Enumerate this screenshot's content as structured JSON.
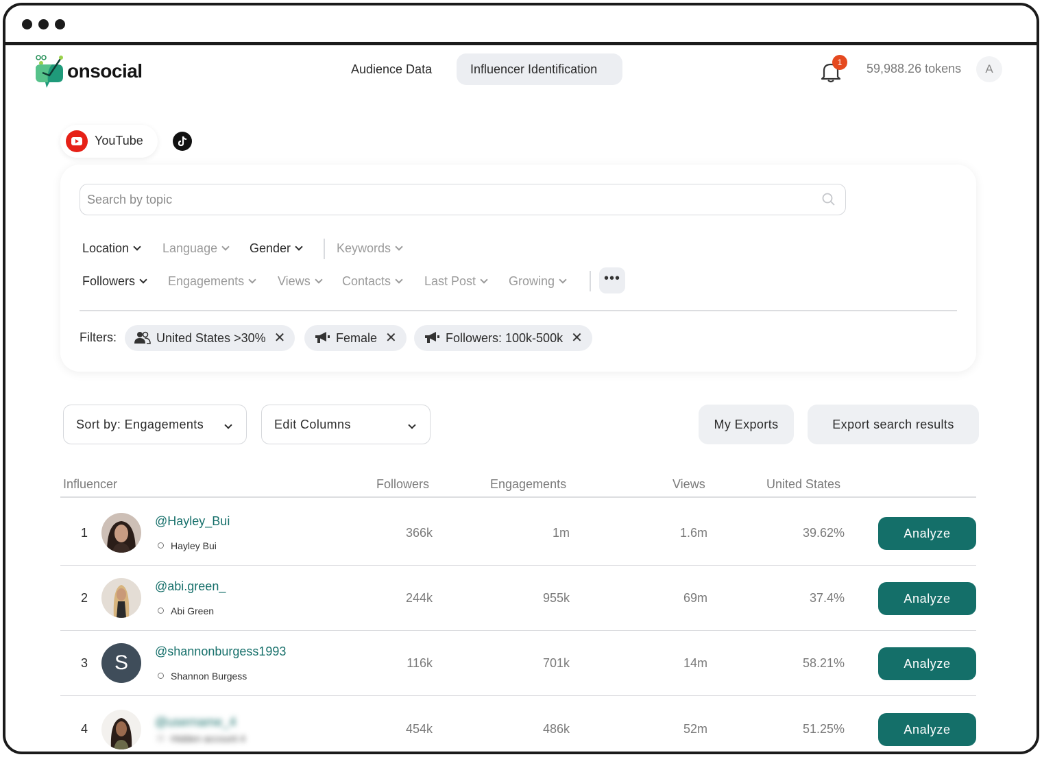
{
  "app": {
    "logo_text": "onsocial"
  },
  "nav": {
    "items": [
      {
        "label": "Audience Data",
        "active": false
      },
      {
        "label": "Influencer Identification",
        "active": true
      }
    ]
  },
  "header": {
    "notification_count": "1",
    "tokens": "59,988.26 tokens",
    "avatar_initial": "A"
  },
  "platforms": [
    {
      "label": "YouTube",
      "icon": "youtube-icon",
      "selected": true
    },
    {
      "label": "",
      "icon": "tiktok-icon",
      "selected": false
    }
  ],
  "search": {
    "placeholder": "Search by topic",
    "value": ""
  },
  "filters_row1": [
    "Location",
    "Language",
    "Gender",
    "Keywords"
  ],
  "filters_row2": [
    "Followers",
    "Engagements",
    "Views",
    "Contacts",
    "Last Post",
    "Growing"
  ],
  "active_filters": {
    "label": "Filters:",
    "chips": [
      {
        "label": "United States >30%",
        "icon": "audience-icon"
      },
      {
        "label": "Female",
        "icon": "megaphone-icon"
      },
      {
        "label": "Followers: 100k-500k",
        "icon": "megaphone-icon"
      }
    ]
  },
  "toolbar": {
    "sort_label": "Sort by: Engagements",
    "edit_columns_label": "Edit Columns",
    "my_exports_label": "My Exports",
    "export_label": "Export search results"
  },
  "table": {
    "columns": [
      "Influencer",
      "Followers",
      "Engagements",
      "Views",
      "United States"
    ],
    "action_label": "Analyze",
    "rows": [
      {
        "rank": "1",
        "handle": "@Hayley_Bui",
        "name": "Hayley Bui",
        "followers": "366k",
        "engagements": "1m",
        "views": "1.6m",
        "us": "39.62%"
      },
      {
        "rank": "2",
        "handle": "@abi.green_",
        "name": "Abi Green",
        "followers": "244k",
        "engagements": "955k",
        "views": "69m",
        "us": "37.4%"
      },
      {
        "rank": "3",
        "handle": "@shannonburgess1993",
        "name": "Shannon Burgess",
        "initial": "S",
        "followers": "116k",
        "engagements": "701k",
        "views": "14m",
        "us": "58.21%"
      },
      {
        "rank": "4",
        "handle": "@username_4",
        "name": "Hidden account 4",
        "followers": "454k",
        "engagements": "486k",
        "views": "52m",
        "us": "51.25%"
      }
    ]
  },
  "colors": {
    "accent": "#146f69",
    "link": "#17706b",
    "badge": "#e5491f",
    "youtube": "#e62117"
  }
}
